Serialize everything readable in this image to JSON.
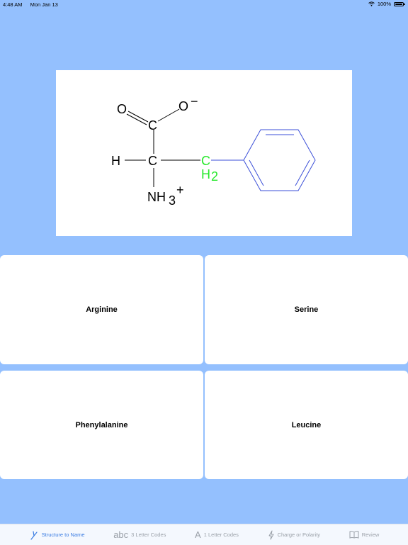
{
  "status": {
    "time": "4:48 AM",
    "date": "Mon Jan 13",
    "battery": "100%"
  },
  "structure": {
    "atoms": {
      "carbonyl_o": "O",
      "carboxylate_o": "O",
      "carboxylate_charge": "−",
      "carboxyl_c": "C",
      "h": "H",
      "alpha_c": "C",
      "amine_n": "NH",
      "amine_sub": "3",
      "amine_charge": "+",
      "side_c": "C",
      "side_h": "H",
      "side_sub": "2"
    },
    "colors": {
      "side_chain": "#27e82b",
      "ring": "#3b4fd8"
    }
  },
  "answers": [
    "Arginine",
    "Serine",
    "Phenylalanine",
    "Leucine"
  ],
  "tabs": [
    {
      "label": "Structure to Name",
      "icon": "tuning-fork-icon",
      "active": true
    },
    {
      "label": "3 Letter Codes",
      "icon_text": "abc",
      "active": false
    },
    {
      "label": "1 Letter Codes",
      "icon_text": "A",
      "active": false
    },
    {
      "label": "Charge or Polarity",
      "icon": "bolt-icon",
      "active": false
    },
    {
      "label": "Review",
      "icon": "book-icon",
      "active": false
    }
  ]
}
